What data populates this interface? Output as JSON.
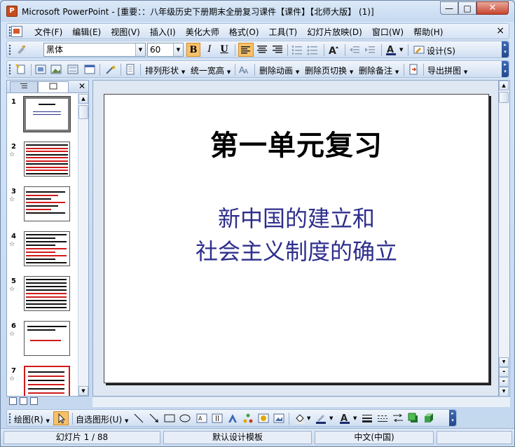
{
  "window": {
    "title": "Microsoft PowerPoint - [重要：：八年级历史下册期末全册复习课件【课件】【北师大版】 (1)]",
    "min_symbol": "—",
    "max_symbol": "□",
    "close_symbol": "✕"
  },
  "menubar": {
    "items": [
      "文件(F)",
      "编辑(E)",
      "视图(V)",
      "插入(I)",
      "美化大师",
      "格式(O)",
      "工具(T)",
      "幻灯片放映(D)",
      "窗口(W)",
      "帮助(H)"
    ],
    "close_symbol": "×"
  },
  "formatting": {
    "font_name": "黑体",
    "font_size": "60",
    "bold": "B",
    "italic": "I",
    "underline": "U",
    "design_label": "设计(S)"
  },
  "toolbar2": {
    "arrange_label": "排列形状",
    "unify_label": "统一宽高",
    "remove_anim_label": "删除动画",
    "remove_trans_label": "删除页切换",
    "remove_notes_label": "删除备注",
    "export_label": "导出拼图"
  },
  "slide": {
    "title": "第一单元复习",
    "subtitle_line1": "新中国的建立和",
    "subtitle_line2": "社会主义制度的确立",
    "subtitle_color": "#2e2e8c"
  },
  "thumbnails": [
    {
      "num": "1",
      "selected": true
    },
    {
      "num": "2"
    },
    {
      "num": "3"
    },
    {
      "num": "4"
    },
    {
      "num": "5"
    },
    {
      "num": "6"
    },
    {
      "num": "7"
    }
  ],
  "drawbar": {
    "draw_label": "绘图(R)",
    "autoshapes_label": "自选图形(U)"
  },
  "status": {
    "slide_info": "幻灯片 1 / 88",
    "template": "默认设计模板",
    "language": "中文(中国)"
  },
  "colors": {
    "accent": "#2a5ba8",
    "close_red": "#c7442d",
    "brand": "#c64b1c"
  }
}
